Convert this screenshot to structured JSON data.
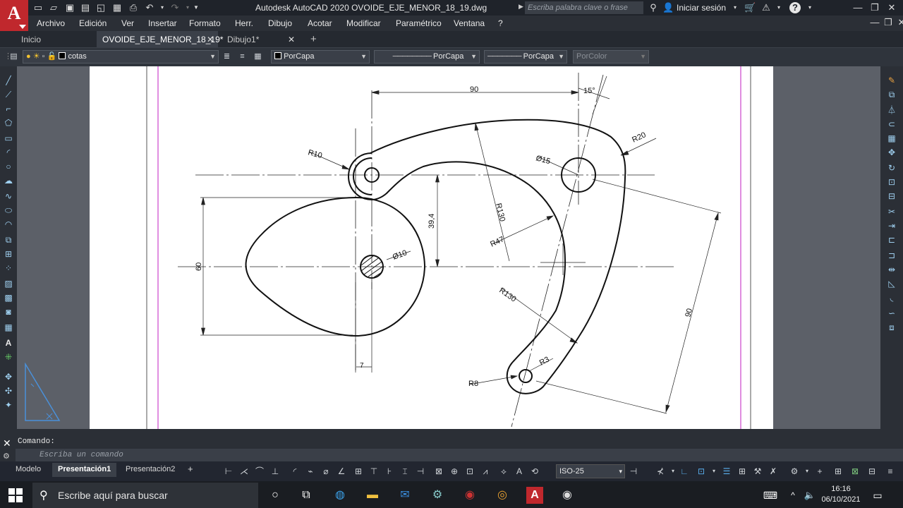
{
  "app": {
    "logo_letter": "A",
    "title": "Autodesk AutoCAD 2020    OVOIDE_EJE_MENOR_18_19.dwg",
    "search_placeholder": "Escriba palabra clave o frase",
    "signin_label": "Iniciar sesión",
    "help_label": "?"
  },
  "menu": {
    "items": [
      "Archivo",
      "Edición",
      "Ver",
      "Insertar",
      "Formato",
      "Herr.",
      "Dibujo",
      "Acotar",
      "Modificar",
      "Paramétrico",
      "Ventana",
      "?"
    ]
  },
  "tabs": {
    "home": "Inicio",
    "items": [
      {
        "label": "OVOIDE_EJE_MENOR_18_19*",
        "active": true
      },
      {
        "label": "Dibujo1*",
        "active": false
      }
    ],
    "add": "+"
  },
  "toolbar": {
    "layer_value": "cotas",
    "color_value": "PorCapa",
    "linetype_value": "PorCapa",
    "lineweight_value": "PorCapa",
    "plotstyle_value": "PorColor"
  },
  "drawing": {
    "dims": {
      "d90_top": "90",
      "ang15": "15°",
      "r20": "R20",
      "r10": "R10",
      "d15": "Ø15",
      "r130a": "R130",
      "d39": "39,4",
      "r47": "R47",
      "d60": "60",
      "d10": "Ø10",
      "r130b": "R130",
      "d90_right": "90",
      "d7": "7",
      "r3": "R3",
      "r8": "R8"
    }
  },
  "command": {
    "history": "Comando:",
    "placeholder": "Escriba un comando"
  },
  "layouts": {
    "model": "Modelo",
    "items": [
      {
        "label": "Presentación1",
        "active": true
      },
      {
        "label": "Presentación2",
        "active": false
      }
    ],
    "add": "+"
  },
  "status": {
    "scale": "ISO-25"
  },
  "taskbar": {
    "search_placeholder": "Escribe aquí para buscar",
    "time": "16:16",
    "date": "06/10/2021"
  },
  "colors": {
    "autocad_red": "#c0282d",
    "viewport_magenta": "#cc44cc",
    "ui_dark": "#2b2f36"
  }
}
